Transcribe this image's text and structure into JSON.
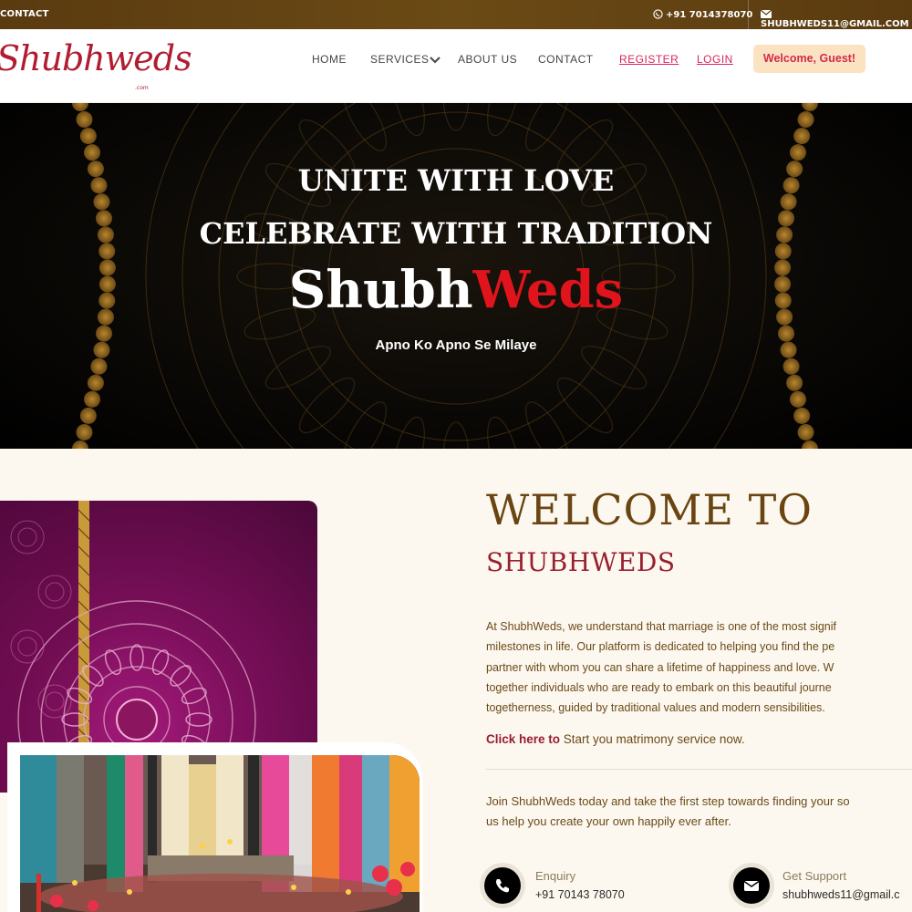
{
  "topbar": {
    "contact_label": "CONTACT",
    "phone": "+91 7014378070",
    "email": "SHUBHWEDS11@GMAIL.COM"
  },
  "nav": {
    "logo_text": "Shubhweds",
    "logo_sub": ".com",
    "items": [
      {
        "label": "HOME"
      },
      {
        "label": "SERVICES"
      },
      {
        "label": "ABOUT US"
      },
      {
        "label": "CONTACT"
      },
      {
        "label": "REGISTER"
      },
      {
        "label": "LOGIN"
      }
    ],
    "welcome": "Welcome, Guest!"
  },
  "hero": {
    "line1": "UNITE WITH LOVE",
    "line2": "CELEBRATE WITH TRADITION",
    "brand_part1": "Shubh",
    "brand_part2": "Weds",
    "tagline": "Apno Ko Apno Se Milaye"
  },
  "welcome": {
    "title": "WELCOME TO",
    "subtitle": "SHUBHWEDS",
    "paragraph_lines": [
      "At ShubhWeds, we understand that marriage is one of the most signif",
      "milestones in life. Our platform is dedicated to helping you find the pe",
      "partner with whom you can share a lifetime of happiness and love. W",
      "together individuals who are ready to embark on this beautiful journe",
      "togetherness, guided by traditional values and modern sensibilities."
    ],
    "click_link": "Click here to",
    "click_rest": " Start you matrimony service now.",
    "join_lines": [
      "Join ShubhWeds today and take the first step towards finding your so",
      "us help you create your own happily ever after."
    ],
    "enquiry_label": "Enquiry",
    "enquiry_value": "+91 70143 78070",
    "support_label": "Get Support",
    "support_value": "shubhweds11@gmail.c"
  },
  "colors": {
    "brand_red": "#b01c30",
    "gold": "#6a4512",
    "topbar": "#5a3b10",
    "accent_pink": "#d6265a"
  },
  "icons": [
    "whatsapp-icon",
    "mail-icon",
    "chevron-down-icon",
    "phone-icon",
    "envelope-icon"
  ]
}
